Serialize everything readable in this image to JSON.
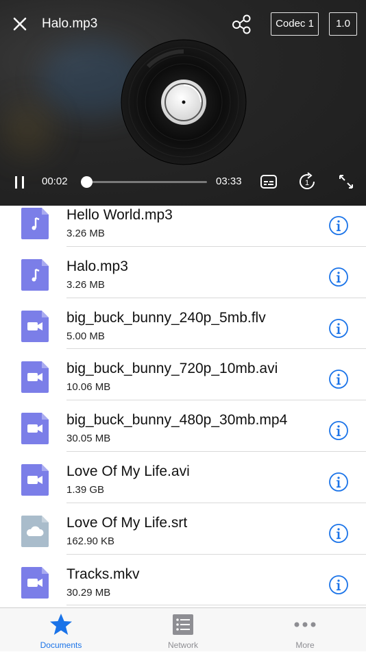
{
  "player": {
    "title": "Halo.mp3",
    "codec_label": "Codec 1",
    "speed_label": "1.0",
    "current_time": "00:02",
    "total_time": "03:33",
    "progress_fraction": 0.01
  },
  "files": [
    {
      "name": "Hello World.mp3",
      "size": "3.26 MB",
      "type": "audio"
    },
    {
      "name": "Halo.mp3",
      "size": "3.26 MB",
      "type": "audio"
    },
    {
      "name": "big_buck_bunny_240p_5mb.flv",
      "size": "5.00 MB",
      "type": "video"
    },
    {
      "name": "big_buck_bunny_720p_10mb.avi",
      "size": "10.06 MB",
      "type": "video"
    },
    {
      "name": "big_buck_bunny_480p_30mb.mp4",
      "size": "30.05 MB",
      "type": "video"
    },
    {
      "name": "Love Of My Life.avi",
      "size": "1.39 GB",
      "type": "video"
    },
    {
      "name": "Love Of My Life.srt",
      "size": "162.90 KB",
      "type": "subtitle"
    },
    {
      "name": "Tracks.mkv",
      "size": "30.29 MB",
      "type": "video"
    }
  ],
  "tabs": [
    {
      "label": "Documents",
      "icon": "star-icon",
      "active": true
    },
    {
      "label": "Network",
      "icon": "list-icon",
      "active": false
    },
    {
      "label": "More",
      "icon": "more-dots-icon",
      "active": false
    }
  ],
  "colors": {
    "accent": "#1a73e8",
    "file_icon": "#7b7ee8",
    "subtitle_icon": "#a9bccb",
    "info": "#1a73e8"
  }
}
